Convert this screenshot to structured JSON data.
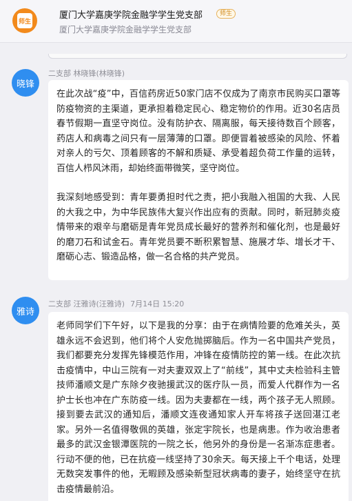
{
  "header": {
    "avatar_text": "师生",
    "title": "厦门大学嘉庚学院金融学学生党支部",
    "badge": "师生",
    "subtitle": "厦门大学嘉庚学院金融学学生党支部"
  },
  "messages": [
    {
      "avatar_text": "晓锋",
      "sender": "二支部 林晓锋(林晓锋)",
      "time": "",
      "paragraphs": [
        "在此次战“疫”中，百信药房近50家门店不仅成为了南京市民购买口罩等防疫物资的主渠道，更承担着稳定民心、稳定物价的作用。近30名店员春节假期一直坚守岗位。没有防护衣、隔离服，每天接待数百个顾客，药店人和病毒之间只有一层薄薄的口罩。即便冒着被感染的风险、怀着对亲人的亏欠、顶着顾客的不解和质疑、承受着超负荷工作量的运转，百信人栉风沐雨，却始终面带微笑，坚守岗位。",
        "我深刻地感受到：青年要勇担时代之责，把小我融入祖国的大我、人民的大我之中，为中华民族伟大复兴作出应有的贡献。同时，新冠肺炎疫情带来的艰辛与磨砺是青年党员成长最好的营养剂和催化剂，也是最好的磨刀石和试金石。青年党员要不断积累智慧、施展才华、增长才干、磨砺心志、锻造品格，做一名合格的共产党员。"
      ]
    },
    {
      "avatar_text": "雅诗",
      "sender": "二支部 汪雅诗(汪雅诗)",
      "time": "7月14日 15:20",
      "paragraphs": [
        "老师同学们下午好，以下是我的分享：由于在病情险要的危难关头，英雄永远不会迟到，他们将个人安危抛掷脑后。作为一名中国共产党员，我们都要充分发挥先锋模范作用，冲锋在疫情防控的第一线。在此次抗击疫情中，中山三院有一对夫妻双双上了“前线”，其中丈夫检验科主管技师潘顺文是广东除夕夜驰援武汉的医疗队一员，而爱人代群作为一名护士长也冲在广东防疫一线。因为夫妻都在一线，两个孩子无人照顾。接到要去武汉的通知后，潘顺文连夜通知家人开车将孩子送回湛江老家。另外一名值得敬佩的英雄，张定宇院长，也是病患。作为收治患者最多的武汉金银潭医院的一院之长，他另外的身份是一名渐冻症患者。行动不便的他，已在抗疫一线坚持了30余天。每天接上千个电话，处理无数突发事件的他，无暇顾及感染新型冠状病毒的妻子，始终坚守在抗击疫情最前沿。"
      ]
    }
  ]
}
